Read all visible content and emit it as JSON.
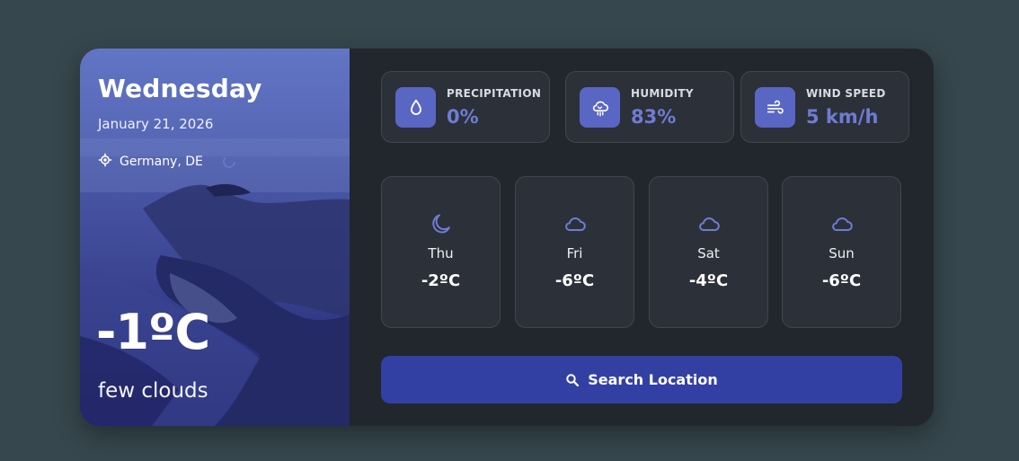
{
  "current": {
    "day": "Wednesday",
    "date": "January 21, 2026",
    "location": "Germany, DE",
    "temperature": "-1ºC",
    "description": "few clouds"
  },
  "stats": [
    {
      "label": "PRECIPITATION",
      "value": "0%",
      "icon": "droplet-icon"
    },
    {
      "label": "HUMIDITY",
      "value": "83%",
      "icon": "cloud-rain-icon"
    },
    {
      "label": "WIND SPEED",
      "value": "5 km/h",
      "icon": "wind-icon"
    }
  ],
  "forecast": [
    {
      "day": "Thu",
      "temp": "-2ºC",
      "icon": "moon-icon"
    },
    {
      "day": "Fri",
      "temp": "-6ºC",
      "icon": "cloud-icon"
    },
    {
      "day": "Sat",
      "temp": "-4ºC",
      "icon": "cloud-icon"
    },
    {
      "day": "Sun",
      "temp": "-6ºC",
      "icon": "cloud-icon"
    }
  ],
  "search": {
    "label": "Search Location",
    "icon": "search-icon"
  },
  "colors": {
    "accent": "#5a66c4",
    "button": "#3340a3",
    "value_text": "#6e7cd4",
    "panel": "#22262d",
    "background": "#36474d"
  }
}
